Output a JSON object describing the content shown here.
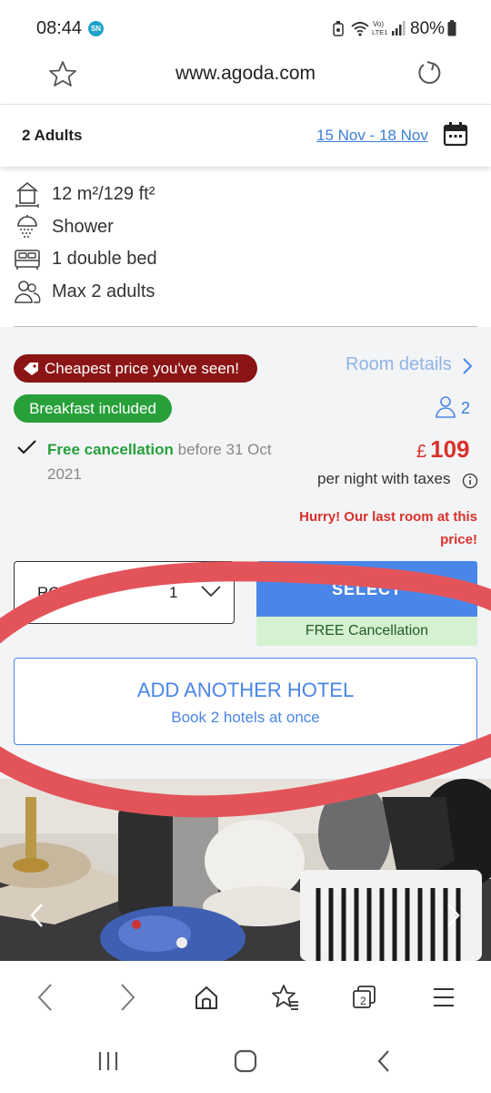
{
  "status_bar": {
    "time": "08:44",
    "badge": "SN",
    "battery": "80%",
    "icons": [
      "alarm-icon",
      "wifi-icon",
      "volte-icon",
      "signal-icon",
      "battery-icon"
    ]
  },
  "browser": {
    "url": "www.agoda.com",
    "icons": [
      "star-icon",
      "reload-icon"
    ]
  },
  "booking": {
    "guests": "2 Adults",
    "dates": "15 Nov - 18 Nov",
    "calendar_icon": "calendar-icon"
  },
  "amenities": [
    {
      "icon": "room-size-icon",
      "label": "12 m²/129 ft²"
    },
    {
      "icon": "shower-icon",
      "label": "Shower"
    },
    {
      "icon": "bed-icon",
      "label": "1 double bed"
    },
    {
      "icon": "people-icon",
      "label": "Max 2 adults"
    }
  ],
  "room_card": {
    "cheapest_badge": "Cheapest price you've seen!",
    "room_details_link": "Room details",
    "breakfast_badge": "Breakfast included",
    "occupancy": "2",
    "free_cancellation_label": "Free cancellation",
    "free_cancellation_rest": " before 31 Oct 2021",
    "currency": "£",
    "price": "109",
    "per_night": "per night with taxes",
    "hurry": "Hurry! Our last room at this price!",
    "rooms_label": "ROOMS",
    "rooms_value": "1",
    "select_label": "SELECT",
    "free_cancellation_strip": "FREE Cancellation",
    "add_hotel_title": "ADD ANOTHER HOTEL",
    "add_hotel_sub": "Book 2 hotels at once"
  },
  "colors": {
    "link_blue": "#4a86e8",
    "price_red": "#d8312b",
    "badge_maroon": "#8b1515",
    "badge_green": "#27a03a",
    "annotation_red": "#e3545a"
  },
  "bottom_toolbar": {
    "icons": [
      "back-icon",
      "forward-icon",
      "home-icon",
      "bookmarks-icon",
      "tabs-icon",
      "menu-icon"
    ],
    "tabs_count": "2"
  },
  "android_nav": {
    "icons": [
      "recents-icon",
      "home-button-icon",
      "back-nav-icon"
    ]
  }
}
